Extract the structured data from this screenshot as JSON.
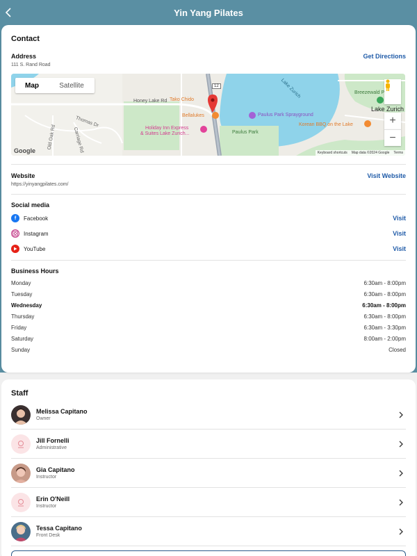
{
  "header": {
    "title": "Yin Yang Pilates"
  },
  "contact": {
    "title": "Contact",
    "address_label": "Address",
    "address_value": "111 S. Rand Road",
    "directions_label": "Get Directions",
    "map": {
      "tab_map": "Map",
      "tab_satellite": "Satellite",
      "labels": {
        "honey_lake": "Honey Lake Rd",
        "tako": "Tako Chido",
        "bellalukes": "Bellalukes",
        "holiday_inn_1": "Holiday Inn Express",
        "holiday_inn_2": "& Suites Lake Zurich...",
        "sprayground": "Paulus Park Sprayground",
        "paulus_park": "Paulus Park",
        "korean": "Korean BBQ on the Lake",
        "lake_zurich_water": "Lake Zurich",
        "lake_zurich_town": "Lake Zurich",
        "breezewald": "Breezewald Park",
        "thomas": "Thomas Dr",
        "old_oak": "Old Oak Rd",
        "carriage": "Carriage Rd",
        "route": "12"
      },
      "attribution": [
        "Keyboard shortcuts",
        "Map data ©2024 Google",
        "Terms"
      ],
      "google": "Google",
      "zoom_in": "+",
      "zoom_out": "−"
    },
    "website_label": "Website",
    "website_value": "https://yinyangpilates.com/",
    "website_link": "Visit Website",
    "social_title": "Social media",
    "social": [
      {
        "name": "Facebook",
        "link": "Visit",
        "color": "#1877f2"
      },
      {
        "name": "Instagram",
        "link": "Visit",
        "color": "#c13584"
      },
      {
        "name": "YouTube",
        "link": "Visit",
        "color": "#e62117"
      }
    ],
    "hours_title": "Business Hours",
    "hours": [
      {
        "day": "Monday",
        "time": "6:30am - 8:00pm"
      },
      {
        "day": "Tuesday",
        "time": "6:30am - 8:00pm"
      },
      {
        "day": "Wednesday",
        "time": "6:30am - 8:00pm"
      },
      {
        "day": "Thursday",
        "time": "6:30am - 8:00pm"
      },
      {
        "day": "Friday",
        "time": "6:30am - 3:30pm"
      },
      {
        "day": "Saturday",
        "time": "8:00am - 2:00pm"
      },
      {
        "day": "Sunday",
        "time": "Closed"
      }
    ]
  },
  "staff": {
    "title": "Staff",
    "members": [
      {
        "name": "Melissa Capitano",
        "role": "Owner"
      },
      {
        "name": "Jill Fornelli",
        "role": "Administrative"
      },
      {
        "name": "Gia Capitano",
        "role": "Instructor"
      },
      {
        "name": "Erin O'Neill",
        "role": "Instructor"
      },
      {
        "name": "Tessa Capitano",
        "role": "Front Desk"
      }
    ]
  },
  "colors": {
    "header_bg": "#5a8fa3",
    "link": "#1f5ba8",
    "water": "#8fd3ea"
  }
}
